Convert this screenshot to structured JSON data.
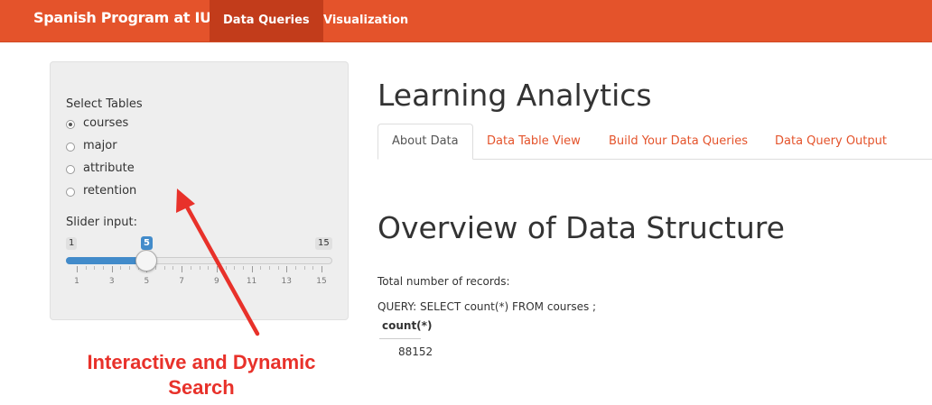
{
  "navbar": {
    "brand": "Spanish Program at IU",
    "items": [
      {
        "label": "Data Queries",
        "active": true
      },
      {
        "label": "Visualization",
        "active": false
      }
    ],
    "color": "#e4532b"
  },
  "sidebar": {
    "select_label": "Select Tables",
    "options": [
      {
        "label": "courses",
        "checked": true
      },
      {
        "label": "major",
        "checked": false
      },
      {
        "label": "attribute",
        "checked": false
      },
      {
        "label": "retention",
        "checked": false
      }
    ],
    "slider": {
      "label": "Slider input:",
      "min": "1",
      "max": "15",
      "value": "5",
      "tick_labels": [
        "1",
        "3",
        "5",
        "7",
        "9",
        "11",
        "13",
        "15"
      ]
    }
  },
  "main": {
    "title": "Learning Analytics",
    "tabs": [
      {
        "label": "About Data",
        "active": true
      },
      {
        "label": "Data Table View",
        "active": false
      },
      {
        "label": "Build Your Data Queries",
        "active": false
      },
      {
        "label": "Data Query Output",
        "active": false
      }
    ],
    "section_title": "Overview of Data Structure",
    "total_label": "Total number of records:",
    "query_text": "QUERY: SELECT count(*) FROM courses ;",
    "table": {
      "header": "count(*)",
      "value": "88152"
    }
  },
  "annotation": {
    "line1": "Interactive and Dynamic",
    "line2": "Search",
    "color": "#e8312a"
  }
}
